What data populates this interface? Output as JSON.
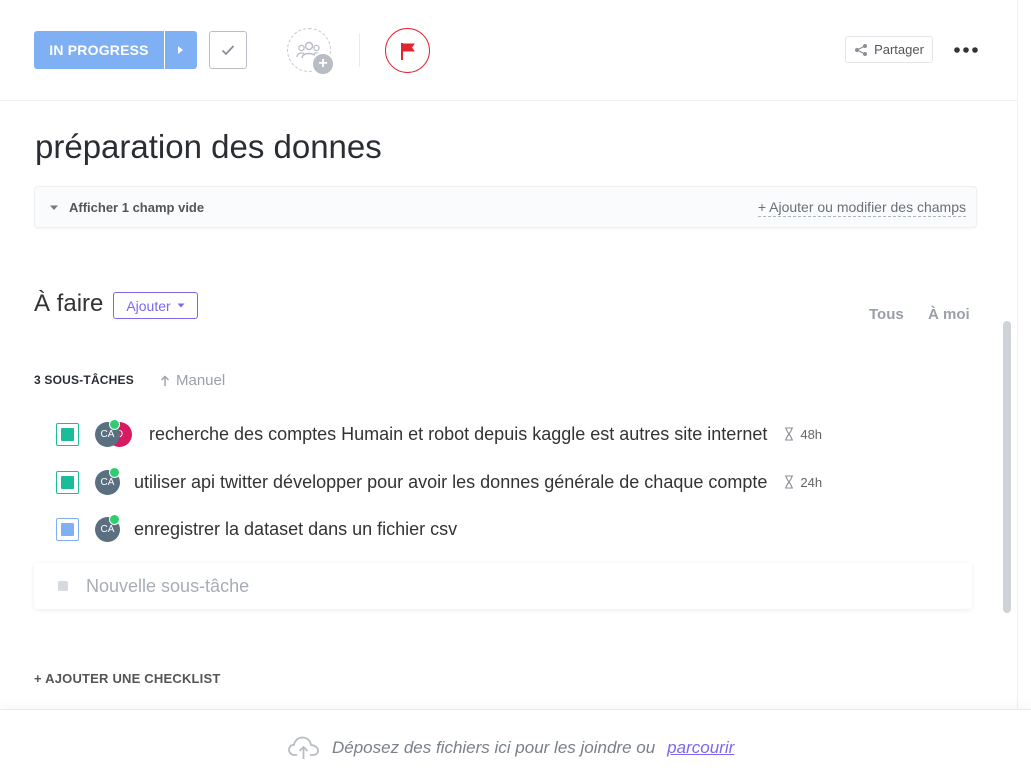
{
  "header": {
    "status_label": "IN PROGRESS",
    "share_label": "Partager",
    "colors": {
      "status": "#7fb0f4",
      "flag": "#e0262f",
      "accent": "#7b68ee"
    }
  },
  "task": {
    "title": "préparation des donnes",
    "fields_toggle": "Afficher 1 champ vide",
    "fields_add": "+ Ajouter ou modifier des champs"
  },
  "todo": {
    "title": "À faire",
    "add_label": "Ajouter",
    "filter_all": "Tous",
    "filter_me": "À moi"
  },
  "subtasks": {
    "count_label": "3 SOUS-TÂCHES",
    "sort_label": "Manuel",
    "items": [
      {
        "name": "recherche des comptes Humain et robot depuis kaggle est autres site internet",
        "estimate": "48h",
        "avatar": "CA",
        "avatar2": "D",
        "status_color": "#1bbc9c"
      },
      {
        "name": "utiliser api twitter développer pour avoir les donnes générale de chaque compte",
        "estimate": "24h",
        "avatar": "CA",
        "status_color": "#1bbc9c"
      },
      {
        "name": "enregistrer la dataset dans un fichier csv",
        "avatar": "CA",
        "status_color": "#7fb0f4"
      }
    ],
    "new_placeholder": "Nouvelle sous-tâche"
  },
  "checklist": {
    "add_label": "+ AJOUTER UNE CHECKLIST"
  },
  "dropzone": {
    "text": "Déposez des fichiers ici pour les joindre ou",
    "link": "parcourir"
  }
}
